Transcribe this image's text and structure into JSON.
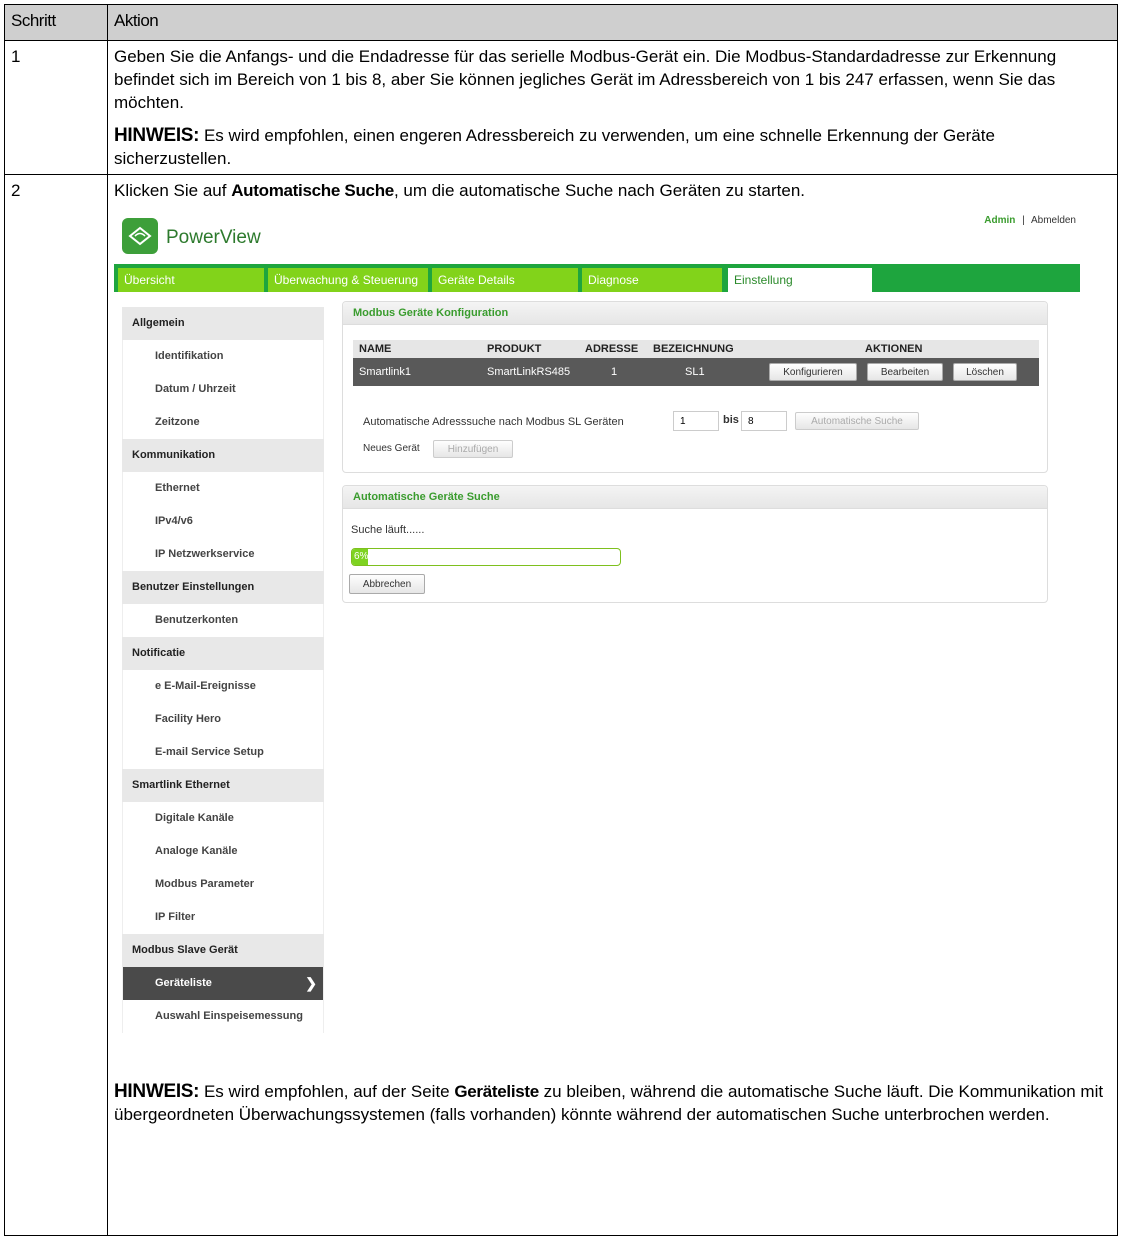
{
  "table": {
    "col_step": "Schritt",
    "col_action": "Aktion",
    "row1": {
      "step": "1",
      "text": "Geben Sie die Anfangs- und die Endadresse für das serielle Modbus-Gerät ein. Die Modbus-Standardadresse zur Erkennung befindet sich im Bereich von 1 bis 8, aber Sie können jegliches Gerät im Adressbereich von 1 bis 247 erfassen, wenn Sie das möchten.",
      "note_label": "HINWEIS:",
      "note_text": " Es wird empfohlen, einen engeren Adressbereich zu verwenden, um eine schnelle Erkennung der Geräte sicherzustellen."
    },
    "row2": {
      "step": "2",
      "text_pre": "Klicken Sie auf ",
      "text_bold": "Automatische Suche",
      "text_post": ", um die automatische Suche nach Geräten zu starten.",
      "note_label": "HINWEIS:",
      "note_pre": " Es wird empfohlen, auf der Seite ",
      "note_bold": "Geräteliste",
      "note_post": " zu bleiben, während die automatische Suche läuft. Die Kommunikation mit übergeordneten Überwachungssystemen (falls vorhanden) könnte während der automatischen Suche unterbrochen werden."
    }
  },
  "app": {
    "brand": "PowerView",
    "user": "Admin",
    "separator": "|",
    "logout": "Abmelden",
    "tabs": [
      "Übersicht",
      "Überwachung & Steuerung",
      "Geräte Details",
      "Diagnose",
      "Einstellung"
    ],
    "active_tab": "Einstellung",
    "sidebar": {
      "groups": [
        {
          "title": "Allgemein",
          "items": [
            "Identifikation",
            "Datum / Uhrzeit",
            "Zeitzone"
          ]
        },
        {
          "title": "Kommunikation",
          "items": [
            "Ethernet",
            "IPv4/v6",
            "IP Netzwerkservice"
          ]
        },
        {
          "title": "Benutzer Einstellungen",
          "items": [
            "Benutzerkonten"
          ]
        },
        {
          "title": "Notificatie",
          "items": [
            "e E-Mail-Ereignisse",
            "Facility Hero",
            "E-mail Service Setup"
          ]
        },
        {
          "title": "Smartlink Ethernet",
          "items": [
            "Digitale Kanäle",
            "Analoge Kanäle",
            "Modbus Parameter",
            "IP Filter"
          ]
        },
        {
          "title": "Modbus Slave Gerät",
          "items": [
            "Geräteliste",
            "Auswahl Einspeisemessung"
          ]
        }
      ],
      "active_item": "Geräteliste"
    },
    "config_panel": {
      "title": "Modbus Geräte Konfiguration",
      "headers": {
        "name": "NAME",
        "product": "PRODUKT",
        "address": "ADRESSE",
        "label": "BEZEICHNUNG",
        "actions": "AKTIONEN"
      },
      "row": {
        "name": "Smartlink1",
        "product": "SmartLinkRS485",
        "address": "1",
        "label": "SL1"
      },
      "btn_configure": "Konfigurieren",
      "btn_edit": "Bearbeiten",
      "btn_delete": "Löschen",
      "auto_label": "Automatische Adresssuche nach Modbus SL Geräten",
      "from_value": "1",
      "to_label": "bis",
      "to_value": "8",
      "btn_auto": "Automatische Suche",
      "new_device_label": "Neues Gerät",
      "btn_add": "Hinzufügen"
    },
    "search_panel": {
      "title": "Automatische Geräte Suche",
      "status": "Suche läuft......",
      "progress_text": "6%",
      "progress": 0.06,
      "btn_cancel": "Abbrechen"
    }
  },
  "colors": {
    "accent": "#1ea53e",
    "tab": "#82d31a",
    "progress": "#7ed321",
    "header_gray": "#cfcfcf"
  }
}
